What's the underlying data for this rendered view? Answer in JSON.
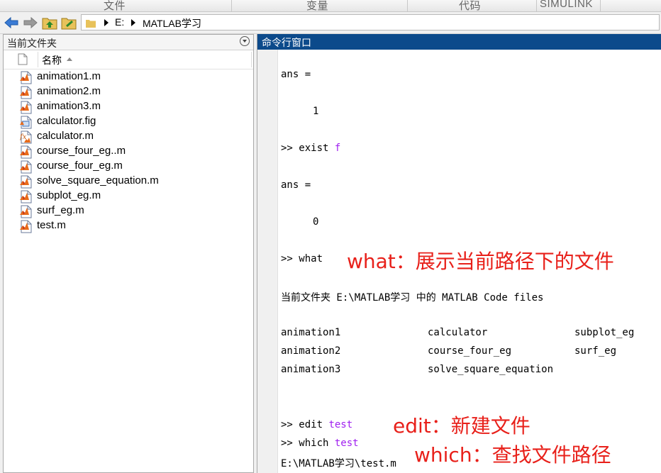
{
  "ribbon": {
    "tabs": [
      "文件",
      "变量",
      "代码",
      "SIMULINK"
    ]
  },
  "address_bar": {
    "segments": [
      "E:",
      "MATLAB学习"
    ]
  },
  "current_folder": {
    "title": "当前文件夹",
    "column_header": "名称",
    "files": [
      {
        "name": "animation1.m",
        "type": "m"
      },
      {
        "name": "animation2.m",
        "type": "m"
      },
      {
        "name": "animation3.m",
        "type": "m"
      },
      {
        "name": "calculator.fig",
        "type": "fig"
      },
      {
        "name": "calculator.m",
        "type": "m-fx"
      },
      {
        "name": "course_four_eg..m",
        "type": "m"
      },
      {
        "name": "course_four_eg.m",
        "type": "m"
      },
      {
        "name": "solve_square_equation.m",
        "type": "m"
      },
      {
        "name": "subplot_eg.m",
        "type": "m"
      },
      {
        "name": "surf_eg.m",
        "type": "m"
      },
      {
        "name": "test.m",
        "type": "m"
      }
    ]
  },
  "command_window": {
    "title": "命令行窗口",
    "ans1_label": "ans =",
    "ans1_value": "1",
    "cmd_exist_prompt": ">> exist",
    "cmd_exist_arg": "f",
    "ans2_label": "ans =",
    "ans2_value": "0",
    "cmd_what": ">> what",
    "what_header": "当前文件夹 E:\\MATLAB学习 中的 MATLAB Code files",
    "what_files": [
      [
        "animation1",
        "calculator",
        "subplot_eg"
      ],
      [
        "animation2",
        "course_four_eg",
        "surf_eg"
      ],
      [
        "animation3",
        "solve_square_equation",
        ""
      ]
    ],
    "cmd_edit_prompt": ">> edit",
    "cmd_edit_arg": "test",
    "cmd_which_prompt": ">> which",
    "cmd_which_arg": "test",
    "which_result": "E:\\MATLAB学习\\test.m"
  },
  "annotations": {
    "what_note": "what：展示当前路径下的文件",
    "edit_note": "edit：新建文件",
    "which_note": "which：查找文件路径",
    "color": "#e8201a"
  },
  "colors": {
    "command_title_bg": "#0c4a8b",
    "keyword": "#a020f0"
  }
}
